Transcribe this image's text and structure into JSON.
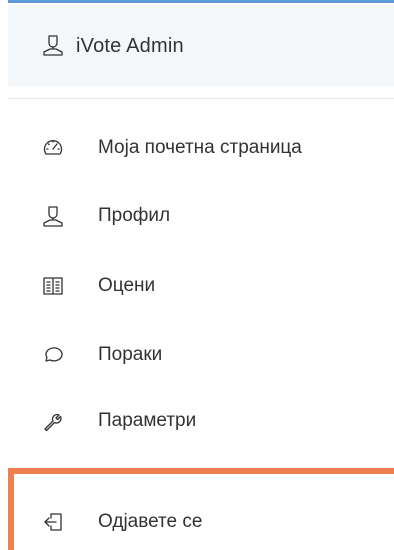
{
  "user": {
    "name": "iVote Admin",
    "icon": "user-icon"
  },
  "menu": {
    "items": [
      {
        "label": "Моја почетна страница",
        "icon": "dashboard-icon"
      },
      {
        "label": "Профил",
        "icon": "user-icon"
      },
      {
        "label": "Оцени",
        "icon": "grades-icon"
      },
      {
        "label": "Пораки",
        "icon": "message-icon"
      },
      {
        "label": "Параметри",
        "icon": "wrench-icon"
      }
    ],
    "logout": {
      "label": "Одјавете се",
      "icon": "logout-icon"
    }
  },
  "colors": {
    "accent_border": "#5b9bd5",
    "highlight": "#ee8050",
    "header_bg": "#f4f7fa",
    "text": "#333333"
  }
}
